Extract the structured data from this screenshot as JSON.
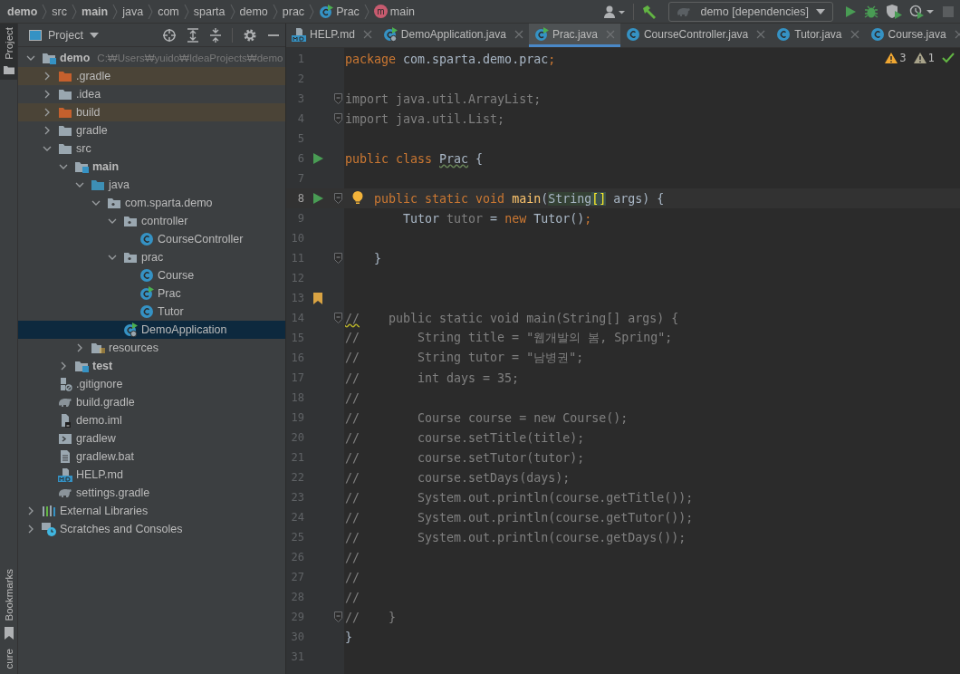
{
  "breadcrumbs": [
    {
      "label": "demo",
      "bold": true
    },
    {
      "label": "src",
      "bold": false
    },
    {
      "label": "main",
      "bold": true
    },
    {
      "label": "java",
      "bold": false
    },
    {
      "label": "com",
      "bold": false
    },
    {
      "label": "sparta",
      "bold": false
    },
    {
      "label": "demo",
      "bold": false
    },
    {
      "label": "prac",
      "bold": false
    },
    {
      "label": "Prac",
      "bold": false,
      "kind": "class-run"
    },
    {
      "label": "main",
      "bold": false,
      "kind": "method",
      "icon_text": "m"
    }
  ],
  "toolbar": {
    "run_config": "demo [dependencies]"
  },
  "side_stripe": {
    "top": [
      {
        "label": "Project",
        "selected": true
      }
    ],
    "bottom": [
      {
        "label": "Bookmarks",
        "selected": false
      },
      {
        "label": "cure",
        "selected": false
      }
    ]
  },
  "project_panel": {
    "title": "Project",
    "tree": [
      {
        "label": "demo",
        "detail": "C:₩Users₩yuido₩IdeaProjects₩demo",
        "kind": "module",
        "bold": true,
        "expanded": true,
        "selected": false,
        "children": [
          {
            "label": ".gradle",
            "kind": "folder",
            "excluded": true,
            "expanded": false,
            "selected": false
          },
          {
            "label": ".idea",
            "kind": "folder",
            "excluded": false,
            "expanded": false,
            "selected": false
          },
          {
            "label": "build",
            "kind": "folder",
            "excluded": true,
            "expanded": false,
            "selected": false
          },
          {
            "label": "gradle",
            "kind": "folder",
            "excluded": false,
            "expanded": false,
            "selected": false
          },
          {
            "label": "src",
            "kind": "folder",
            "excluded": false,
            "expanded": true,
            "selected": false,
            "children": [
              {
                "label": "main",
                "kind": "module-folder",
                "bold": true,
                "expanded": true,
                "selected": false,
                "children": [
                  {
                    "label": "java",
                    "kind": "source-folder",
                    "expanded": true,
                    "selected": false,
                    "children": [
                      {
                        "label": "com.sparta.demo",
                        "kind": "package",
                        "expanded": true,
                        "selected": false,
                        "children": [
                          {
                            "label": "controller",
                            "kind": "package",
                            "expanded": true,
                            "selected": false,
                            "children": [
                              {
                                "label": "CourseController",
                                "kind": "class",
                                "selected": false
                              }
                            ]
                          },
                          {
                            "label": "prac",
                            "kind": "package",
                            "expanded": true,
                            "selected": false,
                            "children": [
                              {
                                "label": "Course",
                                "kind": "class",
                                "selected": false
                              },
                              {
                                "label": "Prac",
                                "kind": "class-run",
                                "selected": false
                              },
                              {
                                "label": "Tutor",
                                "kind": "class",
                                "selected": false
                              }
                            ]
                          },
                          {
                            "label": "DemoApplication",
                            "kind": "spring-app",
                            "selected": true
                          }
                        ]
                      }
                    ]
                  },
                  {
                    "label": "resources",
                    "kind": "resources",
                    "expanded": false,
                    "selected": false
                  }
                ]
              },
              {
                "label": "test",
                "kind": "module-folder",
                "bold": true,
                "expanded": false,
                "selected": false
              }
            ]
          },
          {
            "label": ".gitignore",
            "kind": "ignore-file",
            "selected": false
          },
          {
            "label": "build.gradle",
            "kind": "gradle",
            "selected": false
          },
          {
            "label": "demo.iml",
            "kind": "iml",
            "selected": false
          },
          {
            "label": "gradlew",
            "kind": "script",
            "selected": false
          },
          {
            "label": "gradlew.bat",
            "kind": "text",
            "selected": false
          },
          {
            "label": "HELP.md",
            "kind": "md",
            "selected": false
          },
          {
            "label": "settings.gradle",
            "kind": "gradle",
            "selected": false
          }
        ]
      },
      {
        "label": "External Libraries",
        "kind": "libraries",
        "expanded": false,
        "selected": false
      },
      {
        "label": "Scratches and Consoles",
        "kind": "scratches",
        "expanded": false,
        "selected": false
      }
    ]
  },
  "tabs": [
    {
      "label": "HELP.md",
      "kind": "md",
      "selected": false
    },
    {
      "label": "DemoApplication.java",
      "kind": "spring-app",
      "selected": false
    },
    {
      "label": "Prac.java",
      "kind": "class-run",
      "selected": true
    },
    {
      "label": "CourseController.java",
      "kind": "class",
      "selected": false
    },
    {
      "label": "Tutor.java",
      "kind": "class",
      "selected": false
    },
    {
      "label": "Course.java",
      "kind": "class",
      "selected": false
    }
  ],
  "inspections": {
    "warnings": "3",
    "weak_warnings": "1"
  },
  "code": [
    {
      "n": "1",
      "tokens": [
        {
          "kind": "kw",
          "text": "package "
        },
        {
          "kind": "plain",
          "text": "com.sparta.demo.prac"
        },
        {
          "kind": "kw",
          "text": ";"
        }
      ]
    },
    {
      "n": "2"
    },
    {
      "n": "3",
      "fold": true,
      "tokens": [
        {
          "kind": "unused",
          "text": "import java.util.ArrayList;"
        }
      ]
    },
    {
      "n": "4",
      "fold": true,
      "tokens": [
        {
          "kind": "unused",
          "text": "import java.util.List;"
        }
      ]
    },
    {
      "n": "5"
    },
    {
      "n": "6",
      "kind": "run",
      "tokens": [
        {
          "kind": "kw",
          "text": "public class "
        },
        {
          "kind": "warn",
          "text": "Prac"
        },
        {
          "kind": "plain",
          "text": " {"
        }
      ]
    },
    {
      "n": "7"
    },
    {
      "n": "8",
      "kind": "run",
      "fold": true,
      "current": true,
      "intention": true,
      "tokens": [
        {
          "kind": "kw",
          "text": "    public static void "
        },
        {
          "kind": "method",
          "text": "main"
        },
        {
          "kind": "plain",
          "text": "("
        },
        {
          "kind": "hl",
          "text": "String"
        },
        {
          "kind": "brace",
          "text": "[]"
        },
        {
          "kind": "plain",
          "text": " args) {"
        }
      ]
    },
    {
      "n": "9",
      "tokens": [
        {
          "kind": "plain",
          "text": "        Tutor "
        },
        {
          "kind": "unused",
          "text": "tutor"
        },
        {
          "kind": "plain",
          "text": " = "
        },
        {
          "kind": "kw",
          "text": "new "
        },
        {
          "kind": "plain",
          "text": "Tutor()"
        },
        {
          "kind": "kw",
          "text": ";"
        }
      ]
    },
    {
      "n": "10"
    },
    {
      "n": "11",
      "fold": true,
      "tokens": [
        {
          "kind": "plain",
          "text": "    }"
        }
      ]
    },
    {
      "n": "12"
    },
    {
      "n": "13",
      "kind": "bookmark"
    },
    {
      "n": "14",
      "fold": true,
      "tokens": [
        {
          "kind": "commentwarn",
          "text": "//"
        },
        {
          "kind": "comment",
          "text": "    public static void main(String[] args) {"
        }
      ]
    },
    {
      "n": "15",
      "tokens": [
        {
          "kind": "comment",
          "text": "//        String title = \"웹개발의 봄, Spring\";"
        }
      ]
    },
    {
      "n": "16",
      "tokens": [
        {
          "kind": "comment",
          "text": "//        String tutor = \"남병권\";"
        }
      ]
    },
    {
      "n": "17",
      "tokens": [
        {
          "kind": "comment",
          "text": "//        int days = 35;"
        }
      ]
    },
    {
      "n": "18",
      "tokens": [
        {
          "kind": "comment",
          "text": "//"
        }
      ]
    },
    {
      "n": "19",
      "tokens": [
        {
          "kind": "comment",
          "text": "//        Course course = new Course();"
        }
      ]
    },
    {
      "n": "20",
      "tokens": [
        {
          "kind": "comment",
          "text": "//        course.setTitle(title);"
        }
      ]
    },
    {
      "n": "21",
      "tokens": [
        {
          "kind": "comment",
          "text": "//        course.setTutor(tutor);"
        }
      ]
    },
    {
      "n": "22",
      "tokens": [
        {
          "kind": "comment",
          "text": "//        course.setDays(days);"
        }
      ]
    },
    {
      "n": "23",
      "tokens": [
        {
          "kind": "comment",
          "text": "//        System.out.println(course.getTitle());"
        }
      ]
    },
    {
      "n": "24",
      "tokens": [
        {
          "kind": "comment",
          "text": "//        System.out.println(course.getTutor());"
        }
      ]
    },
    {
      "n": "25",
      "tokens": [
        {
          "kind": "comment",
          "text": "//        System.out.println(course.getDays());"
        }
      ]
    },
    {
      "n": "26",
      "tokens": [
        {
          "kind": "comment",
          "text": "//"
        }
      ]
    },
    {
      "n": "27",
      "tokens": [
        {
          "kind": "comment",
          "text": "//"
        }
      ]
    },
    {
      "n": "28",
      "tokens": [
        {
          "kind": "comment",
          "text": "//"
        }
      ]
    },
    {
      "n": "29",
      "fold": true,
      "tokens": [
        {
          "kind": "comment",
          "text": "//    }"
        }
      ]
    },
    {
      "n": "30",
      "tokens": [
        {
          "kind": "plain",
          "text": "}"
        }
      ]
    },
    {
      "n": "31"
    }
  ]
}
